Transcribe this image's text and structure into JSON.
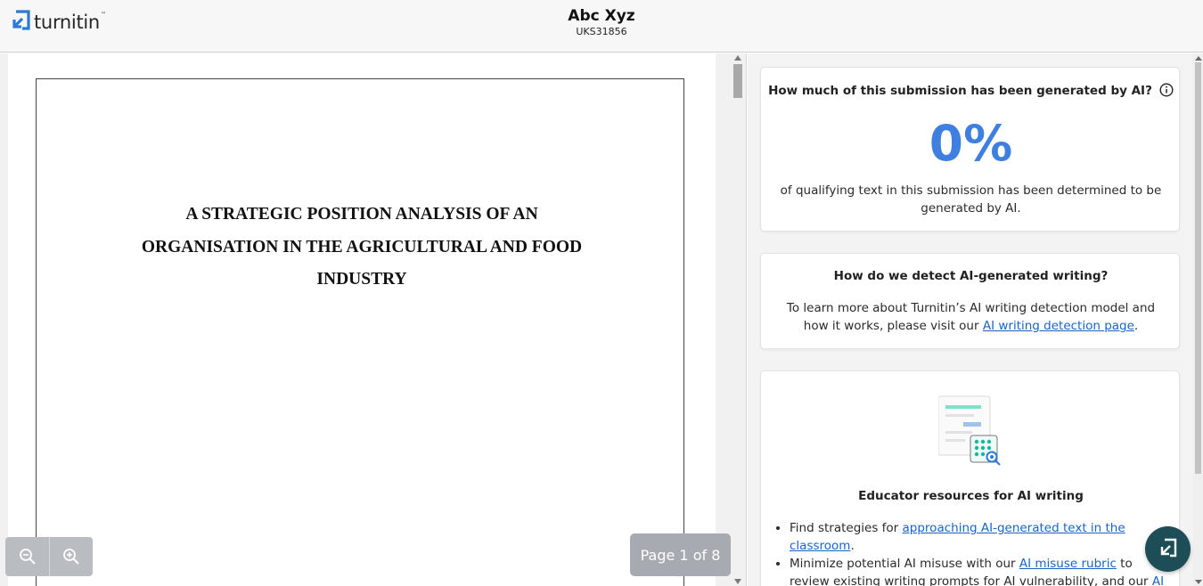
{
  "header": {
    "logo_text": "turnitin",
    "logo_tm": "™",
    "student_name": "Abc Xyz",
    "student_id": "UKS31856"
  },
  "document": {
    "title_lines": [
      "A STRATEGIC POSITION ANALYSIS OF AN",
      "ORGANISATION IN THE AGRICULTURAL AND FOOD",
      "INDUSTRY"
    ],
    "page_indicator": "Page 1 of 8"
  },
  "ai_summary": {
    "question": "How much of this submission has been generated by AI?",
    "percent": "0%",
    "description": "of qualifying text in this submission has been determined to be generated by AI."
  },
  "detection_info": {
    "question": "How do we detect AI-generated writing?",
    "text_before": "To learn more about Turnitin’s AI writing detection model and how it works, please visit our ",
    "link": "AI writing detection page",
    "text_after": "."
  },
  "educator": {
    "title": "Educator resources for AI writing",
    "item1_before": "Find strategies for ",
    "item1_link": "approaching AI-generated text in the classroom",
    "item1_after": ".",
    "item2_before": "Minimize potential AI misuse with our ",
    "item2_link": "AI misuse rubric",
    "item2_middle": " to review existing writing prompts for AI vulnerability, and our ",
    "item2_link2": "AI misuse"
  },
  "icons": {
    "logo": "turnitin-logo-icon",
    "zoom_out": "zoom-out-icon",
    "zoom_in": "zoom-in-icon",
    "info": "info-icon",
    "fab": "turnitin-assistant-icon"
  },
  "colors": {
    "accent_blue": "#3f7fe0",
    "link": "#1a64c8",
    "fab": "#1d4d56"
  }
}
